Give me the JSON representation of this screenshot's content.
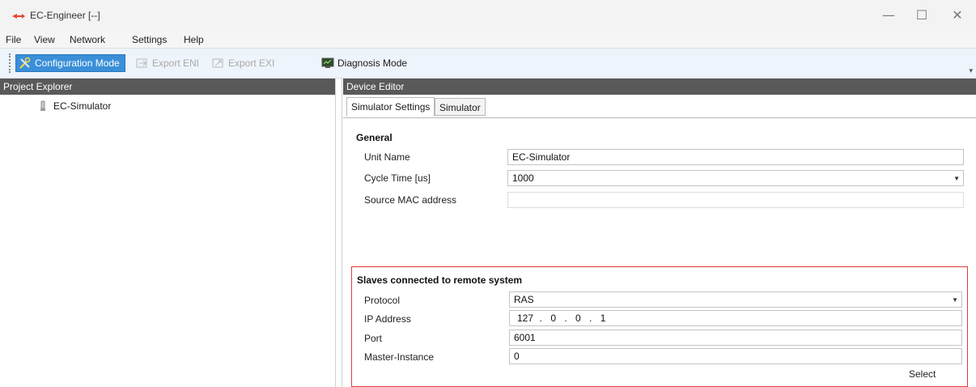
{
  "window": {
    "title": "EC-Engineer [--]",
    "minimize_glyph": "—",
    "maximize_glyph": "☐",
    "close_glyph": "✕"
  },
  "menu": {
    "items": [
      "File",
      "View",
      "Network",
      "Settings",
      "Help"
    ]
  },
  "toolbar": {
    "configuration_mode": "Configuration Mode",
    "export_eni": "Export ENI",
    "export_exi": "Export EXI",
    "diagnosis_mode": "Diagnosis Mode",
    "overflow_glyph": "▾"
  },
  "project_explorer": {
    "header": "Project Explorer",
    "items": [
      {
        "label": "EC-Simulator",
        "icon": "device-icon"
      }
    ]
  },
  "device_editor": {
    "header": "Device Editor",
    "tabs": [
      "Simulator Settings",
      "Simulator"
    ],
    "general": {
      "title": "General",
      "unit_name_label": "Unit Name",
      "unit_name_value": "EC-Simulator",
      "cycle_time_label": "Cycle Time [us]",
      "cycle_time_value": "1000",
      "source_mac_label": "Source MAC address",
      "source_mac_value": ""
    },
    "remote": {
      "title": "Slaves connected to remote system",
      "protocol_label": "Protocol",
      "protocol_value": "RAS",
      "ip_label": "IP Address",
      "ip_octets": [
        "127",
        "0",
        "0",
        "1"
      ],
      "ip_separator": ".",
      "port_label": "Port",
      "port_value": "6001",
      "master_instance_label": "Master-Instance",
      "master_instance_value": "0",
      "select_label": "Select"
    }
  },
  "colors": {
    "accent": "#3a8fd8",
    "panel_header": "#595959",
    "highlight_border": "#e03a3a",
    "toolbar_bg": "#eef4fb"
  }
}
